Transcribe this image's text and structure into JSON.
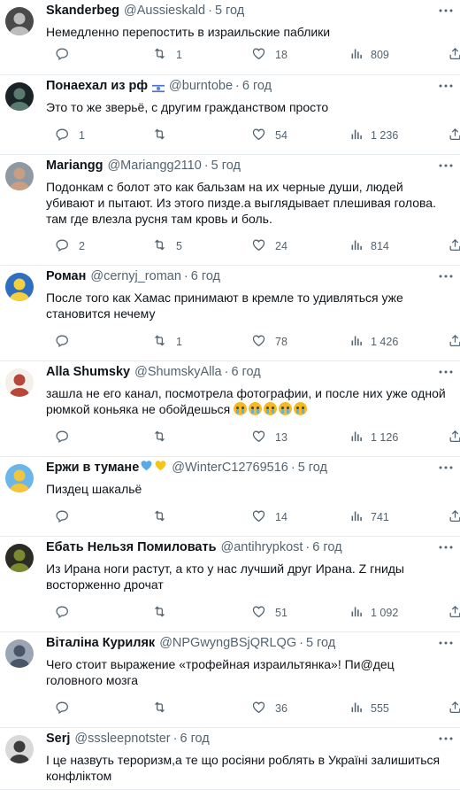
{
  "tweets": [
    {
      "author": "Skanderbeg",
      "handle": "@Aussieskald",
      "time": "5 год",
      "text": "Немедленно перепостить в израильские паблики",
      "reply_count": "",
      "retweet_count": "1",
      "like_count": "18",
      "view_count": "809",
      "avatar_colors": [
        "#4a4a4a",
        "#bdbdbd"
      ]
    },
    {
      "author": "Понаехал из рф",
      "handle": "@burntobe",
      "time": "6 год",
      "text": "Это то же зверьё, с другим гражданством просто",
      "reply_count": "1",
      "retweet_count": "",
      "like_count": "54",
      "view_count": "1 236",
      "avatar_colors": [
        "#1a2326",
        "#5a7a70"
      ]
    },
    {
      "author": "Mariangg",
      "handle": "@Mariangg2110",
      "time": "5 год",
      "text": "Подонкам с болот это как бальзам на их черные души, людей убивают и пытают. Из этого пизде.а выглядывает плешивая голова. там где влезла русня там кровь и боль.",
      "reply_count": "2",
      "retweet_count": "5",
      "like_count": "24",
      "view_count": "814",
      "avatar_colors": [
        "#8d9aa4",
        "#c99e82"
      ]
    },
    {
      "author": "Роман",
      "handle": "@cernyj_roman",
      "time": "6 год",
      "text": "После того как Хамас принимают в кремле то удивляться уже становится нечему",
      "reply_count": "",
      "retweet_count": "1",
      "like_count": "78",
      "view_count": "1 426",
      "avatar_colors": [
        "#2f6fc0",
        "#f4d03f"
      ]
    },
    {
      "author": "Alla Shumsky",
      "handle": "@ShumskyAlla",
      "time": "6 год",
      "text": "зашла не его канал, посмотрела фотографии, и после них уже одной рюмкой коньяка не обойдешься",
      "emoji_count": "5",
      "reply_count": "",
      "retweet_count": "",
      "like_count": "13",
      "view_count": "1 126",
      "avatar_colors": [
        "#f3efe9",
        "#b5483b"
      ]
    },
    {
      "author": "Ержи в тумане",
      "handle": "@WinterC12769516",
      "time": "5 год",
      "text": "Пиздец шакальё",
      "reply_count": "",
      "retweet_count": "",
      "like_count": "14",
      "view_count": "741",
      "avatar_colors": [
        "#6bb6e8",
        "#f2c53d"
      ]
    },
    {
      "author": "Ебать Нельзя Помиловать",
      "handle": "@antihrypkost",
      "time": "6 год",
      "text": "Из Ирана ноги растут, а кто у нас лучший друг Ирана. Z гниды восторженно дрочат",
      "reply_count": "",
      "retweet_count": "",
      "like_count": "51",
      "view_count": "1 092",
      "avatar_colors": [
        "#2c2c24",
        "#7a8a2e"
      ]
    },
    {
      "author": "Віталіна Куриляк",
      "handle": "@NPGwyngBSjQRLQG",
      "time": "5 год",
      "text": "Чего стоит выражение «трофейная израильтянка»! Пи@дец головного мозга",
      "reply_count": "",
      "retweet_count": "",
      "like_count": "36",
      "view_count": "555",
      "avatar_colors": [
        "#9aa6b4",
        "#4a5568"
      ]
    },
    {
      "author": "Serj",
      "handle": "@sssleepnotster",
      "time": "6 год",
      "text": "І це назвуть тероризм,а те що росіяни роблять в Україні залишиться конфліктом",
      "reply_count": "",
      "retweet_count": "",
      "like_count": "",
      "view_count": "",
      "avatar_colors": [
        "#d9d9d9",
        "#3b3b3b"
      ]
    }
  ],
  "colors": {
    "text": "#0f1419",
    "secondary": "#536471",
    "divider": "#e6ecf0",
    "heart_blue": "#5aa8e8",
    "heart_yellow": "#f5c518",
    "flag_blue": "#0038b8"
  }
}
